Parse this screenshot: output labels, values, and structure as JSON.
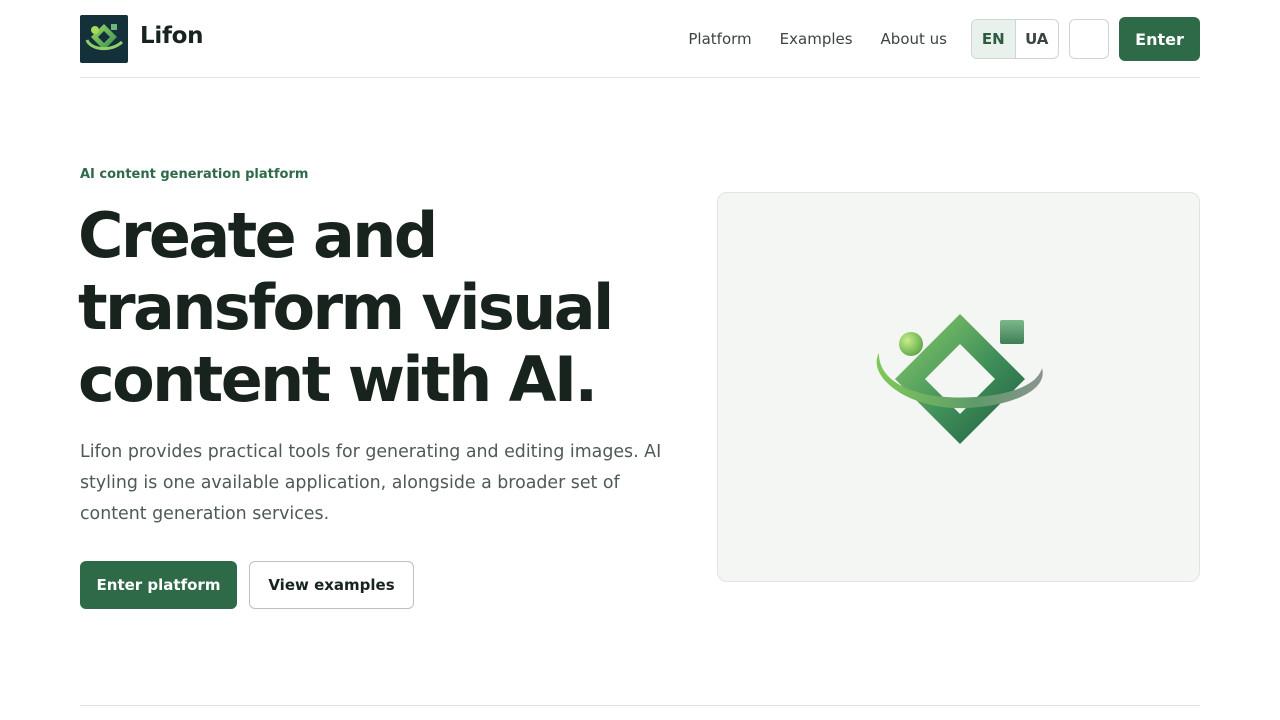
{
  "header": {
    "brand": "Lifon",
    "nav": [
      "Platform",
      "Examples",
      "About us"
    ],
    "languages": [
      "EN",
      "UA"
    ],
    "active_language": "EN",
    "enter_label": "Enter"
  },
  "hero": {
    "eyebrow": "AI content generation platform",
    "headline_lines": [
      "Create and",
      "transform visual",
      "content with AI."
    ],
    "lead": "Lifon provides practical tools for generating and editing images. AI styling is one available application, alongside a broader set of content generation services.",
    "primary_cta": "Enter platform",
    "secondary_cta": "View examples"
  },
  "colors": {
    "brand_green": "#2f6a48",
    "logo_bg": "#14303a"
  },
  "icons": {
    "logo": "lifon-logo-icon",
    "theme_toggle": "theme-toggle-icon"
  }
}
